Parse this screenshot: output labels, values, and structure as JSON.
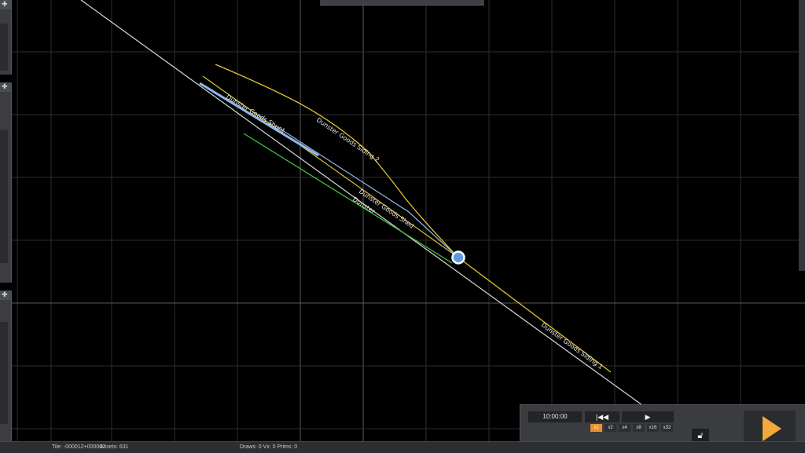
{
  "map": {
    "tracks": [
      {
        "label": "Dunster Goods Shunt"
      },
      {
        "label": "Dunster Goods Siding 2"
      },
      {
        "label": "Dunster Goods Shed"
      },
      {
        "label": "Dunster"
      },
      {
        "label": "Dunster Goods Siding 1"
      }
    ],
    "colors": {
      "background": "#000000",
      "grid": "#3a3a3a",
      "mainline": "#d8d8d8",
      "siding": "#e0c338",
      "selected": "#8fb8e8",
      "platform": "#3ec43e"
    }
  },
  "left_panels": {
    "icon": "pin-icon"
  },
  "time_controls": {
    "time": "10:00:00",
    "rewind_icon": "skip-back-icon",
    "play_icon": "play-icon",
    "speeds": [
      "x1",
      "x2",
      "x4",
      "x8",
      "x16",
      "x32"
    ],
    "active_speed": "x1"
  },
  "lock_icon": "unlock-icon",
  "start_icon": "start-play-icon",
  "status_bar": {
    "tile": "Tile: -000012+000007",
    "assets": "Assets: 631",
    "draws": "Draws: 0 Vx: 0 Prims: 0"
  }
}
